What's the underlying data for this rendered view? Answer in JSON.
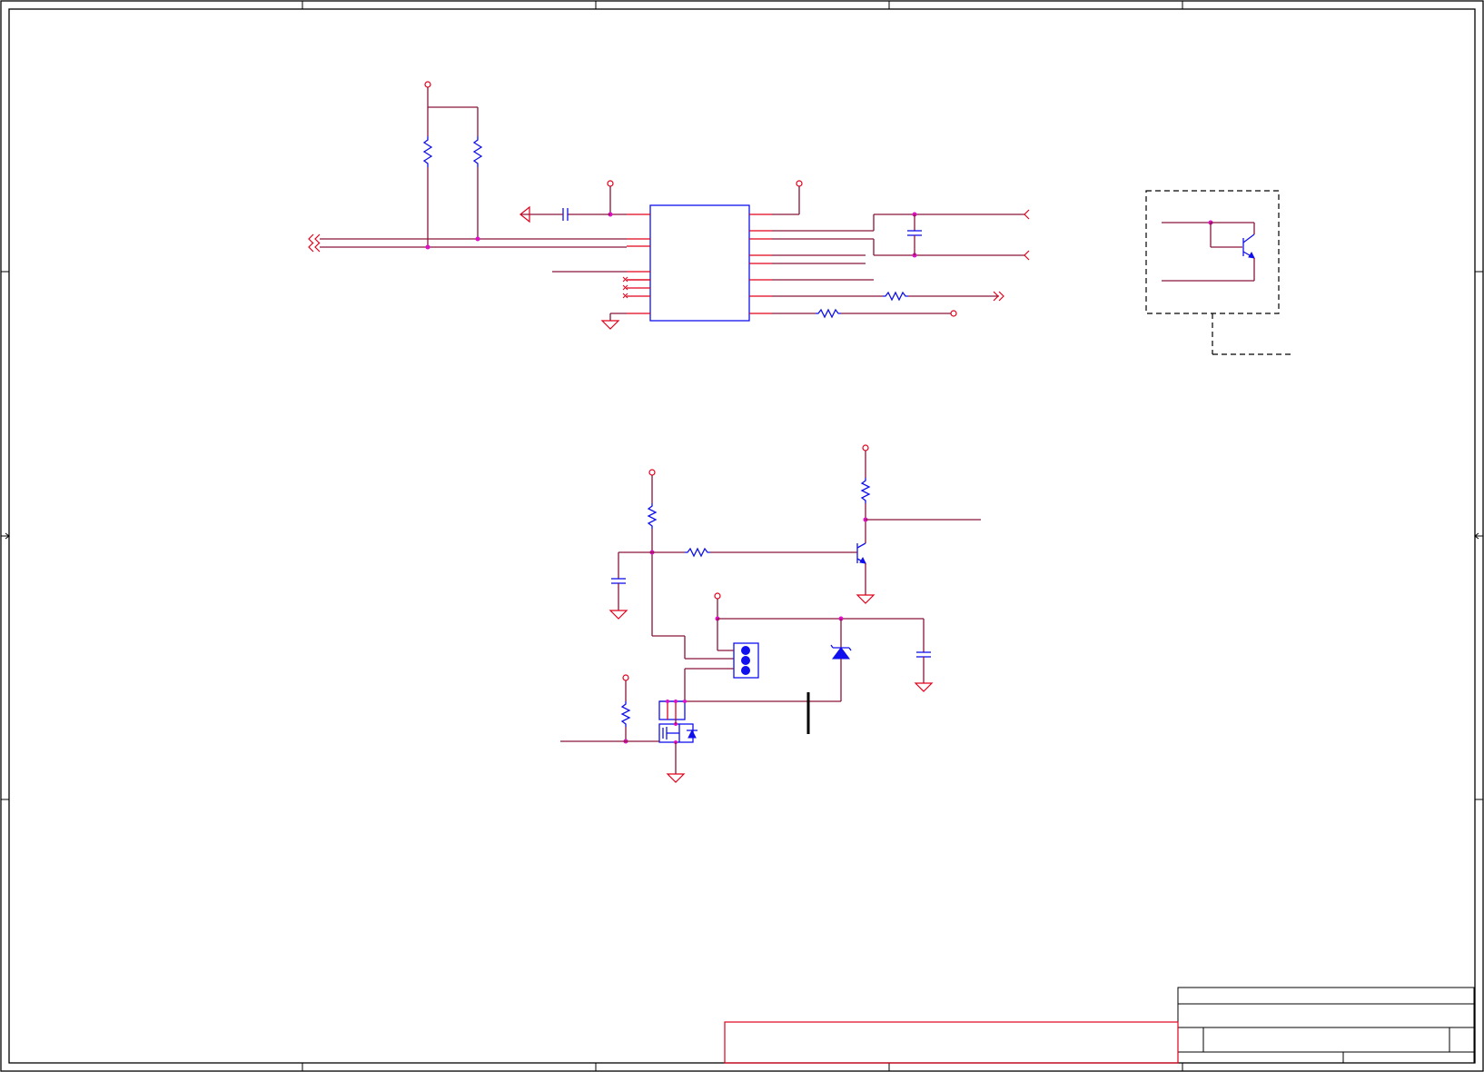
{
  "schematic": {
    "colors": {
      "wire": "#8a1538",
      "pin": "#e0001b",
      "component_body": "#1010ee",
      "junction": "#e010c8",
      "frame": "#000000",
      "background": "#ffffff"
    },
    "blocks": [
      "driver-ic-section",
      "reference-transistor-box",
      "transistor-switch-section",
      "mosfet-relay-section"
    ],
    "components": [
      "ic-u1",
      "resistor",
      "capacitor",
      "npn-transistor",
      "n-mosfet",
      "zener-diode",
      "three-pin-connector",
      "ground-symbol",
      "power-port",
      "off-page-connector"
    ],
    "title_block": {
      "sheet_title": "",
      "size": "",
      "document_number": "",
      "revision": "",
      "date": "",
      "sheet": ""
    }
  }
}
